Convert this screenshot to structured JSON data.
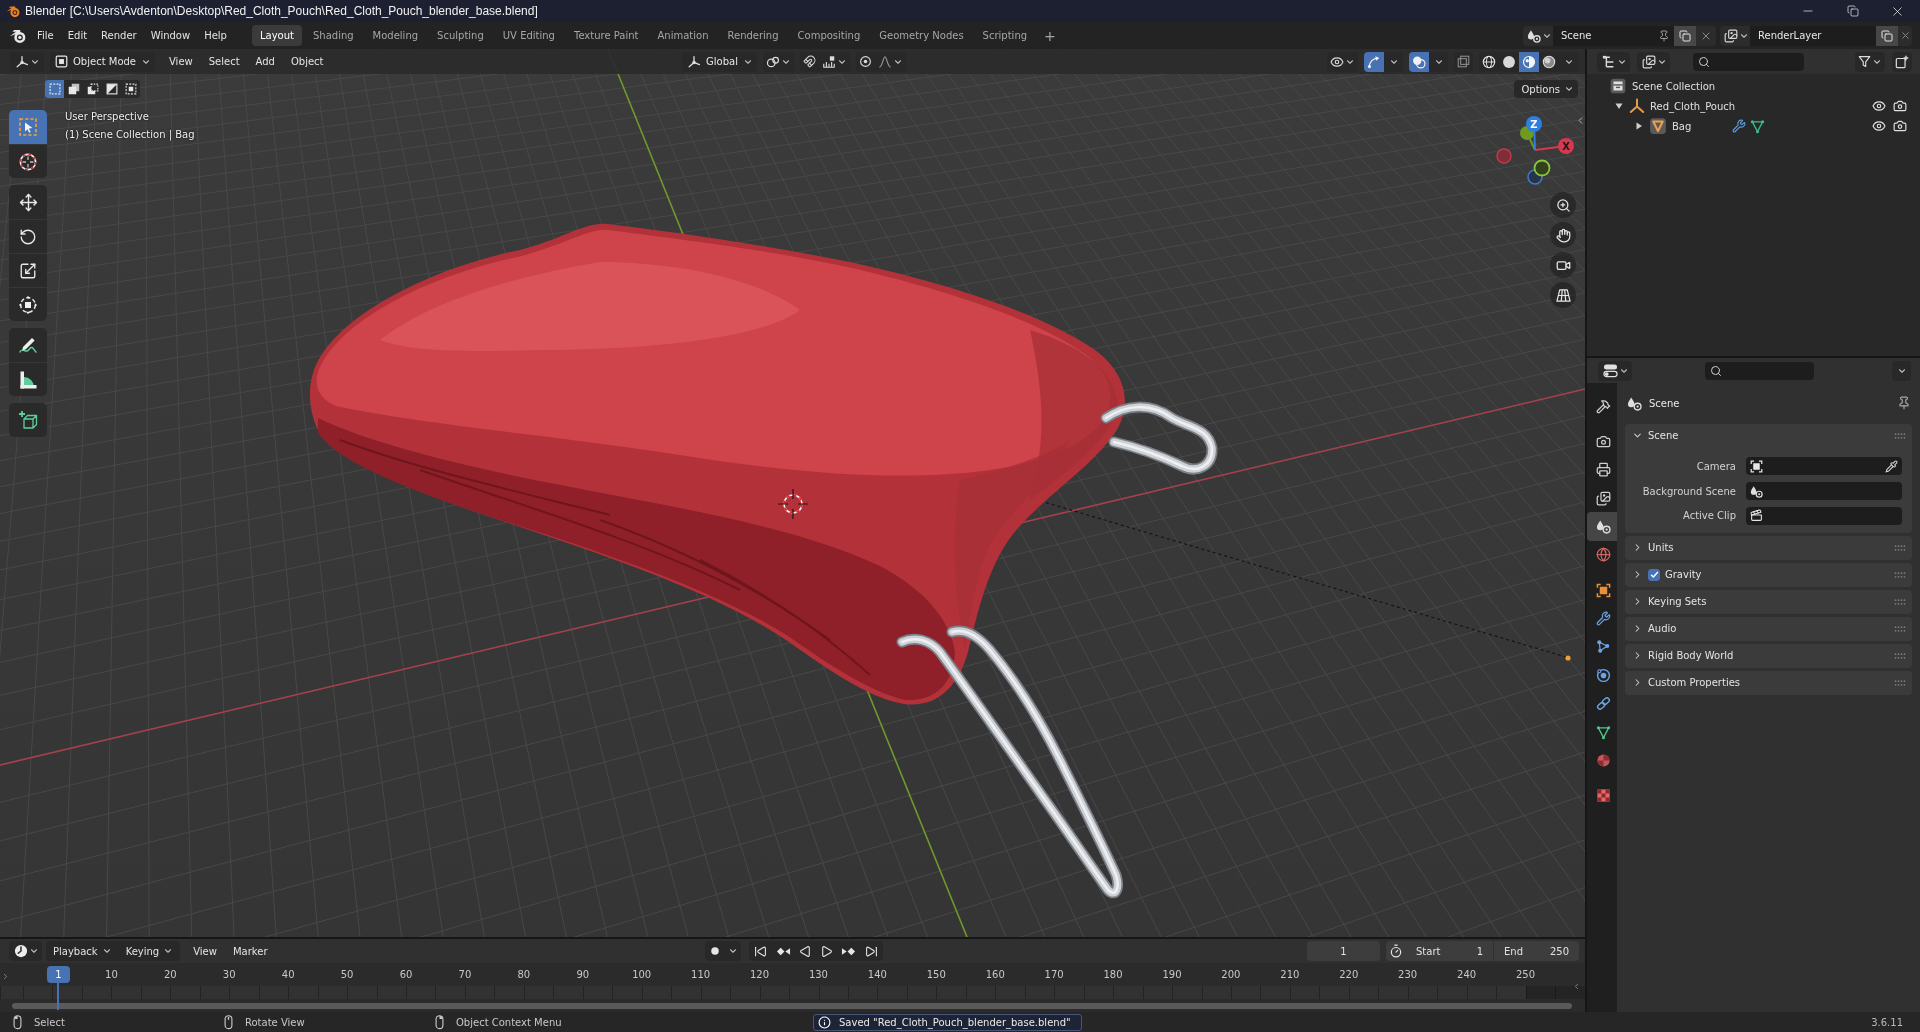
{
  "window": {
    "title": "Blender [C:\\Users\\Avdenton\\Desktop\\Red_Cloth_Pouch\\Red_Cloth_Pouch_blender_base.blend]"
  },
  "menu": [
    "File",
    "Edit",
    "Render",
    "Window",
    "Help"
  ],
  "workspaces": [
    {
      "label": "Layout",
      "selected": true
    },
    {
      "label": "Shading",
      "selected": false
    },
    {
      "label": "Modeling",
      "selected": false
    },
    {
      "label": "Sculpting",
      "selected": false
    },
    {
      "label": "UV Editing",
      "selected": false
    },
    {
      "label": "Texture Paint",
      "selected": false
    },
    {
      "label": "Animation",
      "selected": false
    },
    {
      "label": "Rendering",
      "selected": false
    },
    {
      "label": "Compositing",
      "selected": false
    },
    {
      "label": "Geometry Nodes",
      "selected": false
    },
    {
      "label": "Scripting",
      "selected": false
    }
  ],
  "add_workspace": "+",
  "scene": {
    "value": "Scene"
  },
  "view_layer": {
    "value": "RenderLayer"
  },
  "viewport": {
    "mode": "Object Mode",
    "menus": [
      "View",
      "Select",
      "Add",
      "Object"
    ],
    "orientation": "Global",
    "snap": false,
    "proportional": false,
    "gizmos": true,
    "overlays": true,
    "xray": false,
    "shading": [
      {
        "kind": "wireframe",
        "selected": false
      },
      {
        "kind": "solid",
        "selected": false
      },
      {
        "kind": "material",
        "selected": true
      },
      {
        "kind": "rendered",
        "selected": false
      }
    ],
    "select_modes": [
      {
        "kind": "set",
        "selected": true
      },
      {
        "kind": "extend",
        "selected": false
      },
      {
        "kind": "subtract",
        "selected": false
      },
      {
        "kind": "invert",
        "selected": false
      },
      {
        "kind": "intersect",
        "selected": false
      }
    ],
    "options": "Options",
    "view_name": "User Perspective",
    "view_context": "(1) Scene Collection | Bag",
    "tool_groups": [
      {
        "tools": [
          {
            "kind": "select-box",
            "selected": true
          },
          {
            "kind": "cursor",
            "selected": false
          }
        ]
      },
      {
        "tools": [
          {
            "kind": "move",
            "selected": false
          },
          {
            "kind": "rotate",
            "selected": false
          },
          {
            "kind": "scale",
            "selected": false
          },
          {
            "kind": "transform",
            "selected": false
          }
        ]
      },
      {
        "tools": [
          {
            "kind": "annotate",
            "selected": false
          },
          {
            "kind": "measure",
            "selected": false
          }
        ]
      },
      {
        "tools": [
          {
            "kind": "add-cube",
            "selected": false
          }
        ]
      }
    ],
    "gizmo": {
      "z": "Z",
      "x": "X"
    }
  },
  "outliner": {
    "tree": [
      {
        "label": "Scene Collection",
        "kind": "scene-collection",
        "children": [
          {
            "label": "Red_Cloth_Pouch",
            "kind": "empty",
            "expanded": true,
            "visible": true,
            "renderable": true,
            "children": [
              {
                "label": "Bag",
                "kind": "mesh",
                "expanded": false,
                "modifiers": true,
                "visible": true,
                "renderable": true
              }
            ]
          }
        ]
      }
    ]
  },
  "properties": {
    "tab_groups": [
      {
        "tabs": [
          {
            "kind": "tool",
            "selected": false
          }
        ]
      },
      {
        "tabs": [
          {
            "kind": "render",
            "selected": false
          },
          {
            "kind": "output",
            "selected": false
          },
          {
            "kind": "view-layer",
            "selected": false
          },
          {
            "kind": "scene",
            "selected": true
          },
          {
            "kind": "world",
            "selected": false
          }
        ]
      },
      {
        "tabs": [
          {
            "kind": "object",
            "selected": false
          },
          {
            "kind": "modifiers",
            "selected": false
          },
          {
            "kind": "particles",
            "selected": false
          },
          {
            "kind": "physics",
            "selected": false
          },
          {
            "kind": "constraints",
            "selected": false
          },
          {
            "kind": "data",
            "selected": false
          },
          {
            "kind": "material",
            "selected": false
          }
        ]
      },
      {
        "tabs": [
          {
            "kind": "texture",
            "selected": false
          }
        ]
      }
    ],
    "context_title": "Scene",
    "panels": [
      {
        "title": "Scene",
        "expanded": true,
        "fields": [
          {
            "label": "Camera",
            "kind": "camera"
          },
          {
            "label": "Background Scene",
            "kind": "scene"
          },
          {
            "label": "Active Clip",
            "kind": "clip"
          }
        ]
      },
      {
        "title": "Units",
        "expanded": false
      },
      {
        "title": "Gravity",
        "expanded": false,
        "checked": true
      },
      {
        "title": "Keying Sets",
        "expanded": false
      },
      {
        "title": "Audio",
        "expanded": false
      },
      {
        "title": "Rigid Body World",
        "expanded": false
      },
      {
        "title": "Custom Properties",
        "expanded": false
      }
    ]
  },
  "timeline": {
    "menus": [
      {
        "label": "Playback",
        "dropdown": true
      },
      {
        "label": "Keying",
        "dropdown": true
      },
      {
        "label": "View",
        "dropdown": false
      },
      {
        "label": "Marker",
        "dropdown": false
      }
    ],
    "auto_keying": false,
    "current_frame": "1",
    "start": {
      "label": "Start",
      "value": "1"
    },
    "end": {
      "label": "End",
      "value": "250"
    },
    "playhead": "1",
    "ticks": [
      "10",
      "20",
      "30",
      "40",
      "50",
      "60",
      "70",
      "80",
      "90",
      "100",
      "110",
      "120",
      "130",
      "140",
      "150",
      "160",
      "170",
      "180",
      "190",
      "200",
      "210",
      "220",
      "230",
      "240",
      "250"
    ]
  },
  "status_bar": {
    "hints": [
      {
        "kind": "left-click",
        "label": "Select"
      },
      {
        "kind": "middle-click",
        "label": "Rotate View"
      },
      {
        "kind": "right-click",
        "label": "Object Context Menu"
      }
    ],
    "message": "Saved \"Red_Cloth_Pouch_blender_base.blend\"",
    "version": "3.6.11"
  }
}
